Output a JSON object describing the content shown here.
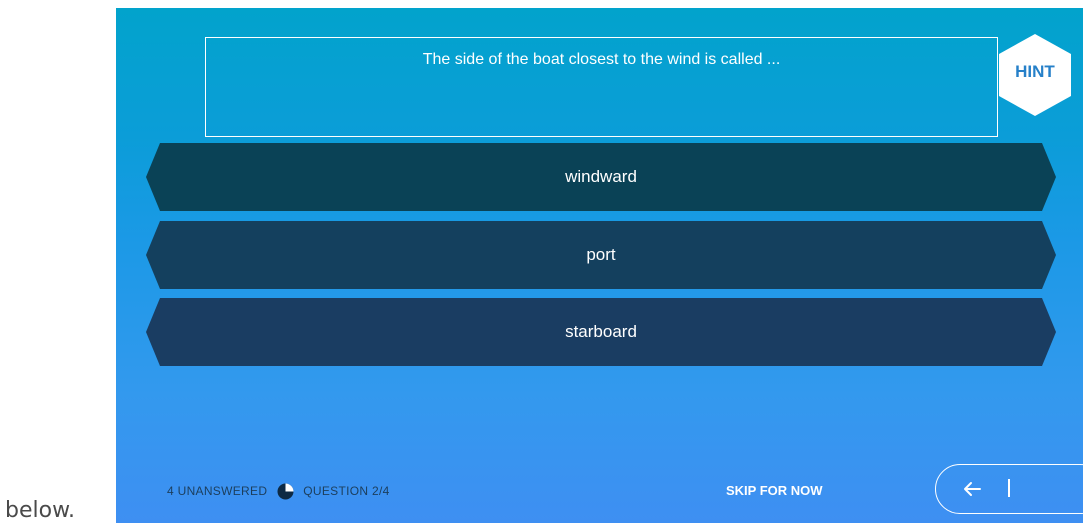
{
  "caption": "below.",
  "question": {
    "text": "The side of the boat closest to the wind is called ..."
  },
  "hint": {
    "label": "HINT"
  },
  "answers": [
    {
      "label": "windward"
    },
    {
      "label": "port"
    },
    {
      "label": "starboard"
    }
  ],
  "footer": {
    "unanswered": "4 UNANSWERED",
    "progress_icon": "pie-progress-icon",
    "question_counter": "QUESTION 2/4",
    "skip_label": "SKIP FOR NOW",
    "back_icon": "arrow-left-icon"
  },
  "colors": {
    "background_top": "#02a3cc",
    "background_bottom": "#3e8ff2",
    "answer_fill": "#14405e",
    "hint_text": "#2680c9"
  }
}
